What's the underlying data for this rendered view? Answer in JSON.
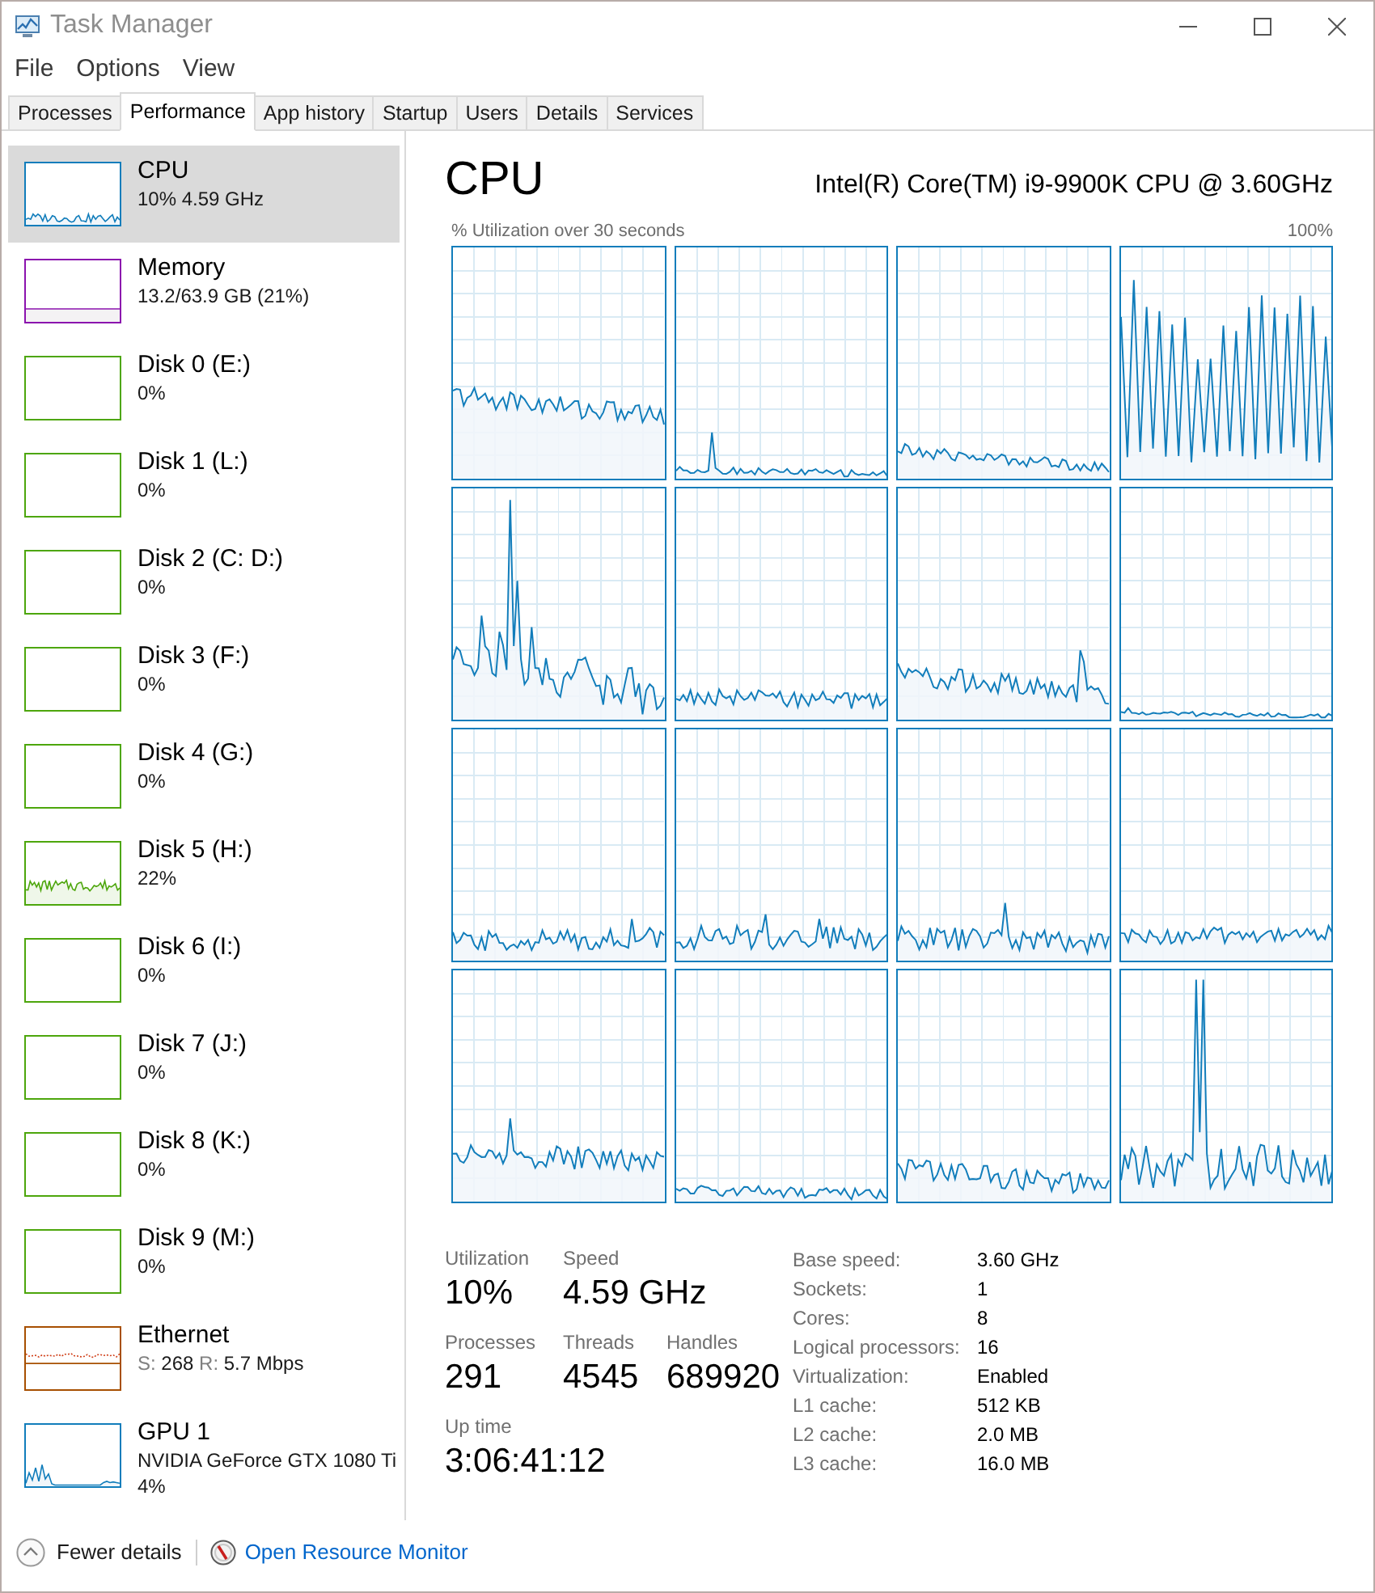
{
  "window": {
    "title": "Task Manager"
  },
  "menu": [
    "File",
    "Options",
    "View"
  ],
  "tabs": [
    {
      "label": "Processes",
      "selected": false
    },
    {
      "label": "Performance",
      "selected": true
    },
    {
      "label": "App history",
      "selected": false
    },
    {
      "label": "Startup",
      "selected": false
    },
    {
      "label": "Users",
      "selected": false
    },
    {
      "label": "Details",
      "selected": false
    },
    {
      "label": "Services",
      "selected": false
    }
  ],
  "sidebar": {
    "items": [
      {
        "kind": "cpu",
        "name": "CPU",
        "details": [
          "10% 4.59 GHz"
        ],
        "selected": true
      },
      {
        "kind": "memory",
        "name": "Memory",
        "details": [
          "13.2/63.9 GB (21%)"
        ],
        "selected": false
      },
      {
        "kind": "disk",
        "name": "Disk 0 (E:)",
        "details": [
          "0%"
        ],
        "selected": false
      },
      {
        "kind": "disk",
        "name": "Disk 1 (L:)",
        "details": [
          "0%"
        ],
        "selected": false
      },
      {
        "kind": "disk",
        "name": "Disk 2 (C: D:)",
        "details": [
          "0%"
        ],
        "selected": false
      },
      {
        "kind": "disk",
        "name": "Disk 3 (F:)",
        "details": [
          "0%"
        ],
        "selected": false
      },
      {
        "kind": "disk",
        "name": "Disk 4 (G:)",
        "details": [
          "0%"
        ],
        "selected": false
      },
      {
        "kind": "disk",
        "name": "Disk 5 (H:)",
        "details": [
          "22%"
        ],
        "selected": false
      },
      {
        "kind": "disk",
        "name": "Disk 6 (I:)",
        "details": [
          "0%"
        ],
        "selected": false
      },
      {
        "kind": "disk",
        "name": "Disk 7 (J:)",
        "details": [
          "0%"
        ],
        "selected": false
      },
      {
        "kind": "disk",
        "name": "Disk 8 (K:)",
        "details": [
          "0%"
        ],
        "selected": false
      },
      {
        "kind": "disk",
        "name": "Disk 9 (M:)",
        "details": [
          "0%"
        ],
        "selected": false
      },
      {
        "kind": "ethernet",
        "name": "Ethernet",
        "throughput": [
          {
            "label": "S:",
            "value": "268"
          },
          {
            "label": "R:",
            "value": "5.7 Mbps"
          }
        ],
        "selected": false
      },
      {
        "kind": "gpu",
        "name": "GPU 1",
        "details": [
          "NVIDIA GeForce GTX 1080 Ti",
          "4%"
        ],
        "selected": false
      }
    ]
  },
  "detail": {
    "title": "CPU",
    "model": "Intel(R) Core(TM) i9-9900K CPU @ 3.60GHz",
    "graph_caption": "% Utilization over 30 seconds",
    "graph_max": "100%",
    "stats": [
      [
        {
          "label": "Utilization",
          "value": "10%"
        },
        {
          "label": "Speed",
          "value": "4.59 GHz"
        }
      ],
      [
        {
          "label": "Processes",
          "value": "291"
        },
        {
          "label": "Threads",
          "value": "4545"
        },
        {
          "label": "Handles",
          "value": "689920"
        }
      ],
      [
        {
          "label": "Up time",
          "value": "3:06:41:12"
        }
      ]
    ],
    "specs": [
      {
        "label": "Base speed:",
        "value": "3.60 GHz"
      },
      {
        "label": "Sockets:",
        "value": "1"
      },
      {
        "label": "Cores:",
        "value": "8"
      },
      {
        "label": "Logical processors:",
        "value": "16"
      },
      {
        "label": "Virtualization:",
        "value": "Enabled"
      },
      {
        "label": "L1 cache:",
        "value": "512 KB"
      },
      {
        "label": "L2 cache:",
        "value": "2.0 MB"
      },
      {
        "label": "L3 cache:",
        "value": "16.0 MB"
      }
    ]
  },
  "footer": {
    "fewer_details": "Fewer details",
    "resource_monitor": "Open Resource Monitor"
  }
}
